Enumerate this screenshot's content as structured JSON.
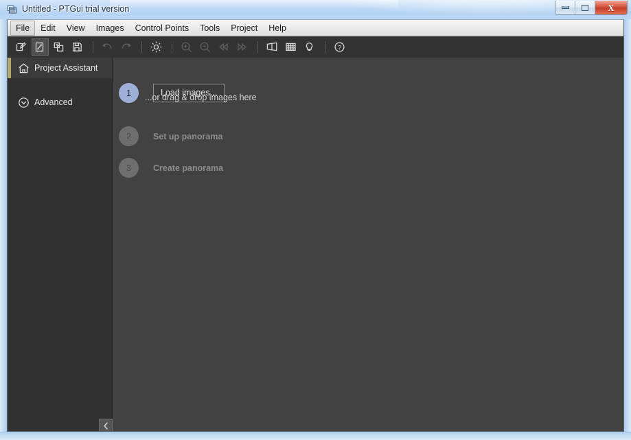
{
  "window": {
    "title": "Untitled - PTGui trial version",
    "app_icon": "panorama-stack-icon",
    "controls": {
      "minimize_label": "–",
      "maximize_label": "",
      "close_label": "X"
    },
    "colors": {
      "titlebar": "#bcd7f2",
      "client_bg": "#3b3b3b",
      "sidebar_bg": "#313131",
      "main_bg": "#424242",
      "accent_selected": "#b5a96a",
      "step_active": "#9fb0d8",
      "step_inactive": "#6e6e6e",
      "close_button": "#c6402b"
    }
  },
  "menubar": {
    "items": [
      {
        "label": "File",
        "active": true
      },
      {
        "label": "Edit",
        "active": false
      },
      {
        "label": "View",
        "active": false
      },
      {
        "label": "Images",
        "active": false
      },
      {
        "label": "Control Points",
        "active": false
      },
      {
        "label": "Tools",
        "active": false
      },
      {
        "label": "Project",
        "active": false
      },
      {
        "label": "Help",
        "active": false
      }
    ]
  },
  "toolbar": {
    "groups": [
      {
        "buttons": [
          {
            "icon": "new-project-icon",
            "enabled": true,
            "pressed": false
          },
          {
            "icon": "open-project-icon",
            "enabled": true,
            "pressed": true
          },
          {
            "icon": "save-as-copy-icon",
            "enabled": true,
            "pressed": false
          },
          {
            "icon": "save-icon",
            "enabled": true,
            "pressed": false
          }
        ]
      },
      {
        "buttons": [
          {
            "icon": "undo-icon",
            "enabled": false,
            "pressed": false
          },
          {
            "icon": "redo-icon",
            "enabled": false,
            "pressed": false
          }
        ]
      },
      {
        "buttons": [
          {
            "icon": "gear-icon",
            "enabled": true,
            "pressed": false
          }
        ]
      },
      {
        "buttons": [
          {
            "icon": "zoom-in-icon",
            "enabled": false,
            "pressed": false
          },
          {
            "icon": "zoom-out-icon",
            "enabled": false,
            "pressed": false
          },
          {
            "icon": "rewind-icon",
            "enabled": false,
            "pressed": false
          },
          {
            "icon": "fast-forward-icon",
            "enabled": false,
            "pressed": false
          }
        ]
      },
      {
        "buttons": [
          {
            "icon": "panorama-layers-icon",
            "enabled": true,
            "pressed": false
          },
          {
            "icon": "grid-icon",
            "enabled": true,
            "pressed": false
          },
          {
            "icon": "lightbulb-icon",
            "enabled": true,
            "pressed": false
          }
        ]
      },
      {
        "buttons": [
          {
            "icon": "help-circle-icon",
            "enabled": true,
            "pressed": false
          }
        ]
      }
    ]
  },
  "sidebar": {
    "items": [
      {
        "label": "Project Assistant",
        "icon": "home-icon",
        "selected": true
      },
      {
        "label": "Advanced",
        "icon": "chevron-down-circle-icon",
        "selected": false
      }
    ],
    "collapse_icon": "chevron-left-icon"
  },
  "main": {
    "steps": [
      {
        "number": "1",
        "state": "active",
        "button_label": "Load images...",
        "hint": "...or drag & drop images here"
      },
      {
        "number": "2",
        "state": "inactive",
        "label": "Set up panorama"
      },
      {
        "number": "3",
        "state": "inactive",
        "label": "Create panorama"
      }
    ]
  }
}
